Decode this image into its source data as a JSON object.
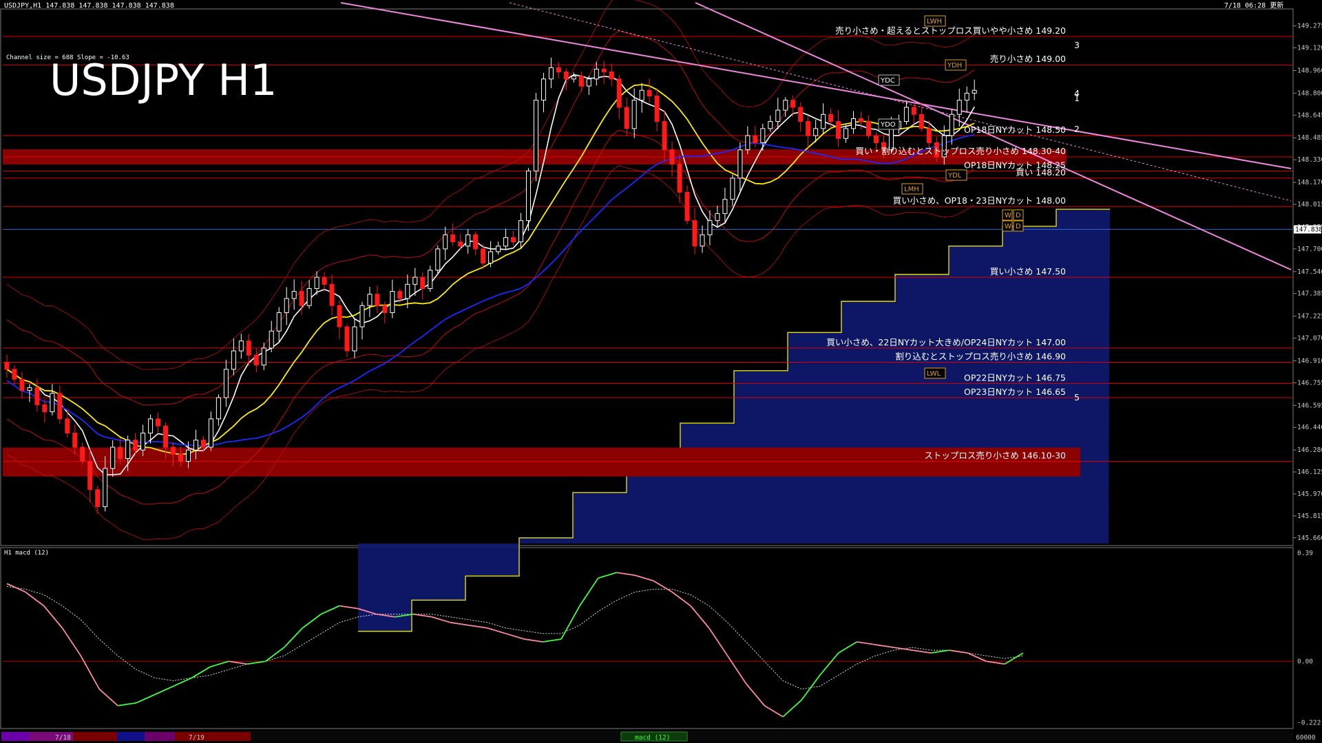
{
  "header": {
    "symbol_line": "USDJPY,H1  147.838 147.838 147.838 147.838",
    "updated": "7/18 06:28 更新",
    "channel_info": "Channel size = 688 Slope = -10.63",
    "title": "USDJPY H1"
  },
  "colors": {
    "bull": "#ffffff",
    "bear": "#ff1a1a",
    "level_line": "#e00000",
    "zone": "#8b0000",
    "ma_fast": "#ffffff",
    "ma_mid": "#ffee00",
    "ma_slow": "#1a2bff",
    "channel": "#ee88dd",
    "bollinger": "#d01010",
    "cloud_line": "#e6dd00",
    "cloud_fill": "#101a70",
    "macd_up": "#40ff40",
    "macd_down": "#ff8aa0"
  },
  "chart_data": [
    {
      "type": "candlestick",
      "title": "USDJPY H1",
      "y_axis_ticks": [
        "149.275",
        "149.120",
        "148.960",
        "148.800",
        "148.645",
        "148.485",
        "148.330",
        "148.170",
        "148.015",
        "147.855",
        "147.700",
        "147.540",
        "147.385",
        "147.225",
        "147.070",
        "146.910",
        "146.755",
        "146.595",
        "146.440",
        "146.280",
        "146.125",
        "145.970",
        "145.815",
        "145.660"
      ],
      "ylim": [
        145.62,
        149.38
      ],
      "current_price": "147.838",
      "x_labels": [
        "7/18",
        "7/19"
      ],
      "close_path": [
        146.85,
        146.78,
        146.7,
        146.72,
        146.6,
        146.55,
        146.68,
        146.5,
        146.4,
        146.3,
        146.2,
        146.0,
        145.88,
        146.15,
        146.3,
        146.22,
        146.35,
        146.28,
        146.4,
        146.5,
        146.45,
        146.3,
        146.25,
        146.2,
        146.28,
        146.35,
        146.3,
        146.5,
        146.65,
        146.85,
        146.98,
        147.05,
        146.95,
        146.88,
        147.0,
        147.12,
        147.25,
        147.35,
        147.4,
        147.3,
        147.42,
        147.5,
        147.45,
        147.3,
        147.15,
        146.98,
        147.15,
        147.3,
        147.38,
        147.3,
        147.25,
        147.4,
        147.35,
        147.45,
        147.5,
        147.42,
        147.55,
        147.7,
        147.8,
        147.75,
        147.72,
        147.8,
        147.7,
        147.6,
        147.68,
        147.72,
        147.78,
        147.75,
        147.9,
        148.25,
        148.75,
        148.9,
        148.98,
        148.95,
        148.9,
        148.92,
        148.85,
        148.9,
        148.97,
        148.95,
        148.9,
        148.7,
        148.55,
        148.75,
        148.82,
        148.78,
        148.6,
        148.4,
        148.3,
        148.1,
        147.9,
        147.72,
        147.8,
        147.9,
        147.95,
        148.05,
        148.2,
        148.4,
        148.5,
        148.45,
        148.55,
        148.6,
        148.68,
        148.75,
        148.7,
        148.6,
        148.5,
        148.55,
        148.65,
        148.6,
        148.48,
        148.55,
        148.62,
        148.6,
        148.5,
        148.45,
        148.4,
        148.55,
        148.6,
        148.7,
        148.65,
        148.55,
        148.45,
        148.35,
        148.5,
        148.65,
        148.75,
        148.8,
        148.82
      ]
    },
    {
      "type": "line",
      "title": "H1 macd (12)",
      "y_axis_ticks": [
        "0.39",
        "0.00",
        "-0.222"
      ],
      "ylim": [
        -0.24,
        0.4
      ],
      "main": [
        0.28,
        0.25,
        0.2,
        0.12,
        0.02,
        -0.1,
        -0.16,
        -0.15,
        -0.12,
        -0.09,
        -0.06,
        -0.02,
        0.0,
        -0.01,
        0.0,
        0.05,
        0.12,
        0.17,
        0.2,
        0.19,
        0.17,
        0.16,
        0.17,
        0.16,
        0.14,
        0.13,
        0.12,
        0.1,
        0.08,
        0.07,
        0.08,
        0.2,
        0.3,
        0.32,
        0.31,
        0.29,
        0.25,
        0.2,
        0.12,
        0.02,
        -0.08,
        -0.16,
        -0.2,
        -0.14,
        -0.05,
        0.03,
        0.07,
        0.06,
        0.05,
        0.04,
        0.03,
        0.04,
        0.03,
        0.0,
        -0.01,
        0.03
      ],
      "signal": [
        0.27,
        0.26,
        0.24,
        0.2,
        0.15,
        0.08,
        0.02,
        -0.03,
        -0.06,
        -0.07,
        -0.06,
        -0.05,
        -0.03,
        -0.01,
        0.0,
        0.02,
        0.06,
        0.1,
        0.14,
        0.16,
        0.17,
        0.17,
        0.17,
        0.17,
        0.16,
        0.15,
        0.14,
        0.12,
        0.11,
        0.1,
        0.1,
        0.13,
        0.18,
        0.22,
        0.25,
        0.26,
        0.26,
        0.24,
        0.2,
        0.14,
        0.07,
        0.0,
        -0.07,
        -0.1,
        -0.09,
        -0.05,
        -0.01,
        0.02,
        0.04,
        0.05,
        0.04,
        0.04,
        0.03,
        0.02,
        0.01,
        0.02
      ],
      "legend_button": "macd (12)"
    }
  ],
  "levels": [
    {
      "price": 149.2,
      "text": "売り小さめ・超えるとストップロス買いやや小さめ 149.20"
    },
    {
      "price": 149.0,
      "text": "売り小さめ 149.00"
    },
    {
      "price": 148.5,
      "text": "OP18日NYカット 148.50"
    },
    {
      "price": 148.35,
      "text": "買い・割り込むとストップロス売り小さめ 148.30-40"
    },
    {
      "price": 148.25,
      "text": "OP18日NYカット 148.25"
    },
    {
      "price": 148.2,
      "text": "買い 148.20"
    },
    {
      "price": 148.0,
      "text": "買い小さめ、OP18・23日NYカット 148.00"
    },
    {
      "price": 147.5,
      "text": "買い小さめ 147.50"
    },
    {
      "price": 147.0,
      "text": "買い小さめ、22日NYカット大きめ/OP24日NYカット 147.00"
    },
    {
      "price": 146.9,
      "text": "割り込むとストップロス売り小さめ 146.90"
    },
    {
      "price": 146.75,
      "text": "OP22日NYカット 146.75"
    },
    {
      "price": 146.65,
      "text": "OP23日NYカット 146.65"
    },
    {
      "price": 146.2,
      "text": "ストップロス売り小さめ 146.10-30"
    }
  ],
  "channel_numbers": [
    "3",
    "4",
    "2",
    "1",
    "5"
  ],
  "badges": [
    "YDH",
    "YDC",
    "YDO",
    "YDL",
    "LMH",
    "LWH",
    "LWL",
    "W",
    "D",
    "W",
    "D"
  ]
}
